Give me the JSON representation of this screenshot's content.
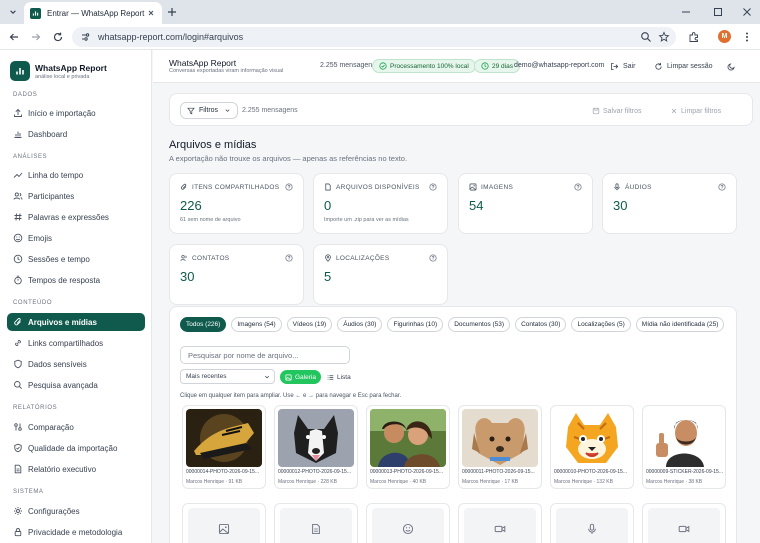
{
  "browser": {
    "tab_title": "Entrar — WhatsApp Report",
    "url": "whatsapp-report.com/login#arquivos",
    "profile_initial": "M"
  },
  "brand": {
    "name": "WhatsApp Report",
    "tagline": "análise local e privada"
  },
  "sidebar": {
    "sections": [
      {
        "label": "DADOS",
        "items": [
          {
            "label": "Início e importação",
            "icon": "upload-icon"
          },
          {
            "label": "Dashboard",
            "icon": "bar-chart-icon"
          }
        ]
      },
      {
        "label": "ANÁLISES",
        "items": [
          {
            "label": "Linha do tempo",
            "icon": "trend-icon"
          },
          {
            "label": "Participantes",
            "icon": "users-icon"
          },
          {
            "label": "Palavras e expressões",
            "icon": "hash-icon"
          },
          {
            "label": "Emojis",
            "icon": "smile-icon"
          },
          {
            "label": "Sessões e tempo",
            "icon": "clock-icon"
          },
          {
            "label": "Tempos de resposta",
            "icon": "timer-icon"
          }
        ]
      },
      {
        "label": "CONTEÚDO",
        "items": [
          {
            "label": "Arquivos e mídias",
            "icon": "paperclip-icon",
            "active": true
          },
          {
            "label": "Links compartilhados",
            "icon": "link-icon"
          },
          {
            "label": "Dados sensíveis",
            "icon": "shield-icon"
          },
          {
            "label": "Pesquisa avançada",
            "icon": "search-icon"
          }
        ]
      },
      {
        "label": "RELATÓRIOS",
        "items": [
          {
            "label": "Comparação",
            "icon": "compare-icon"
          },
          {
            "label": "Qualidade da importação",
            "icon": "check-shield-icon"
          },
          {
            "label": "Relatório executivo",
            "icon": "document-icon"
          }
        ]
      },
      {
        "label": "SISTEMA",
        "items": [
          {
            "label": "Configurações",
            "icon": "gear-icon"
          },
          {
            "label": "Privacidade e metodologia",
            "icon": "lock-icon"
          }
        ]
      }
    ]
  },
  "header": {
    "title": "WhatsApp Report",
    "subtitle": "Conversas exportadas viram informação visual",
    "messages": "2.255 mensagens",
    "processing": "Processamento 100% local",
    "days": "29 dias",
    "email": "demo@whatsapp-report.com",
    "logout": "Sair",
    "clear_session": "Limpar sessão"
  },
  "filters": {
    "button": "Filtros",
    "count": "2.255 mensagens",
    "save": "Salvar filtros",
    "clear": "Limpar filtros"
  },
  "section": {
    "title": "Arquivos e mídias",
    "subtitle": "A exportação não trouxe os arquivos — apenas as referências no texto."
  },
  "cards": [
    {
      "label": "ITENS COMPARTILHADOS",
      "value": "226",
      "note": "61 sem nome de arquivo",
      "icon": "paperclip-icon"
    },
    {
      "label": "ARQUIVOS DISPONÍVEIS",
      "value": "0",
      "note": "Importe um .zip para ver as mídias",
      "icon": "file-icon"
    },
    {
      "label": "IMAGENS",
      "value": "54",
      "note": "",
      "icon": "image-icon"
    },
    {
      "label": "ÁUDIOS",
      "value": "30",
      "note": "",
      "icon": "mic-icon"
    },
    {
      "label": "CONTATOS",
      "value": "30",
      "note": "",
      "icon": "users-icon"
    },
    {
      "label": "LOCALIZAÇÕES",
      "value": "5",
      "note": "",
      "icon": "pin-icon"
    }
  ],
  "gallery": {
    "chips": [
      {
        "label": "Todos (226)",
        "active": true
      },
      {
        "label": "Imagens (54)"
      },
      {
        "label": "Vídeos (19)"
      },
      {
        "label": "Áudios (30)"
      },
      {
        "label": "Figurinhas (10)"
      },
      {
        "label": "Documentos (53)"
      },
      {
        "label": "Contatos (30)"
      },
      {
        "label": "Localizações (5)"
      },
      {
        "label": "Mídia não identificada (25)"
      }
    ],
    "search_placeholder": "Pesquisar por nome de arquivo...",
    "sort": "Mais recentes",
    "view_gallery": "Galeria",
    "view_list": "Lista",
    "hint": "Clique em qualquer item para ampliar. Use ← e → para navegar e Esc para fechar.",
    "items": [
      {
        "filename": "00000014-PHOTO-2026-09-15...",
        "meta": "Marcos Henrique · 91 KB",
        "art": "sneaker"
      },
      {
        "filename": "00000012-PHOTO-2026-09-15...",
        "meta": "Marcos Henrique · 228 KB",
        "art": "dog"
      },
      {
        "filename": "00000013-PHOTO-2026-09-15...",
        "meta": "Marcos Henrique · 40 KB",
        "art": "couple"
      },
      {
        "filename": "00000011-PHOTO-2026-09-15...",
        "meta": "Marcos Henrique · 17 KB",
        "art": "puppy"
      },
      {
        "filename": "00000010-PHOTO-2026-09-15...",
        "meta": "Marcos Henrique · 132 KB",
        "art": "tiger"
      },
      {
        "filename": "00000009-STICKER-2026-09-15...",
        "meta": "Marcos Henrique · 38 KB",
        "art": "man"
      }
    ],
    "row2_icons": [
      "image-icon",
      "document-icon",
      "smile-icon",
      "video-icon",
      "mic-icon",
      "video-icon"
    ]
  }
}
